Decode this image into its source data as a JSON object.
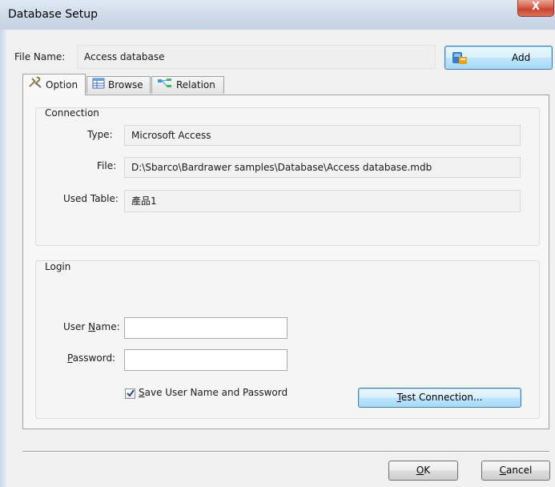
{
  "window": {
    "title": "Database Setup",
    "close_glyph": "X"
  },
  "file_name": {
    "label": "File Name:",
    "value": "Access database"
  },
  "add_button": {
    "label": "Add"
  },
  "tabs": [
    {
      "label": "Option",
      "icon": "tools-icon"
    },
    {
      "label": "Browse",
      "icon": "table-icon"
    },
    {
      "label": "Relation",
      "icon": "relation-icon"
    }
  ],
  "connection": {
    "title": "Connection",
    "type_label": "Type:",
    "type_value": "Microsoft Access",
    "file_label": "File:",
    "file_value": "D:\\Sbarco\\Bardrawer samples\\Database\\Access database.mdb",
    "table_label": "Used Table:",
    "table_value": "產品1"
  },
  "login": {
    "title": "Login",
    "username_label_pre": "User ",
    "username_label_key": "N",
    "username_label_post": "ame:",
    "username_value": "",
    "password_label_key": "P",
    "password_label_post": "assword:",
    "password_value": "",
    "save_key": "S",
    "save_rest": "ave User Name and Password",
    "save_checked": true,
    "test_key": "T",
    "test_rest": "est Connection..."
  },
  "footer": {
    "ok_key": "O",
    "ok_rest": "K",
    "cancel_key": "C",
    "cancel_rest": "ancel"
  }
}
